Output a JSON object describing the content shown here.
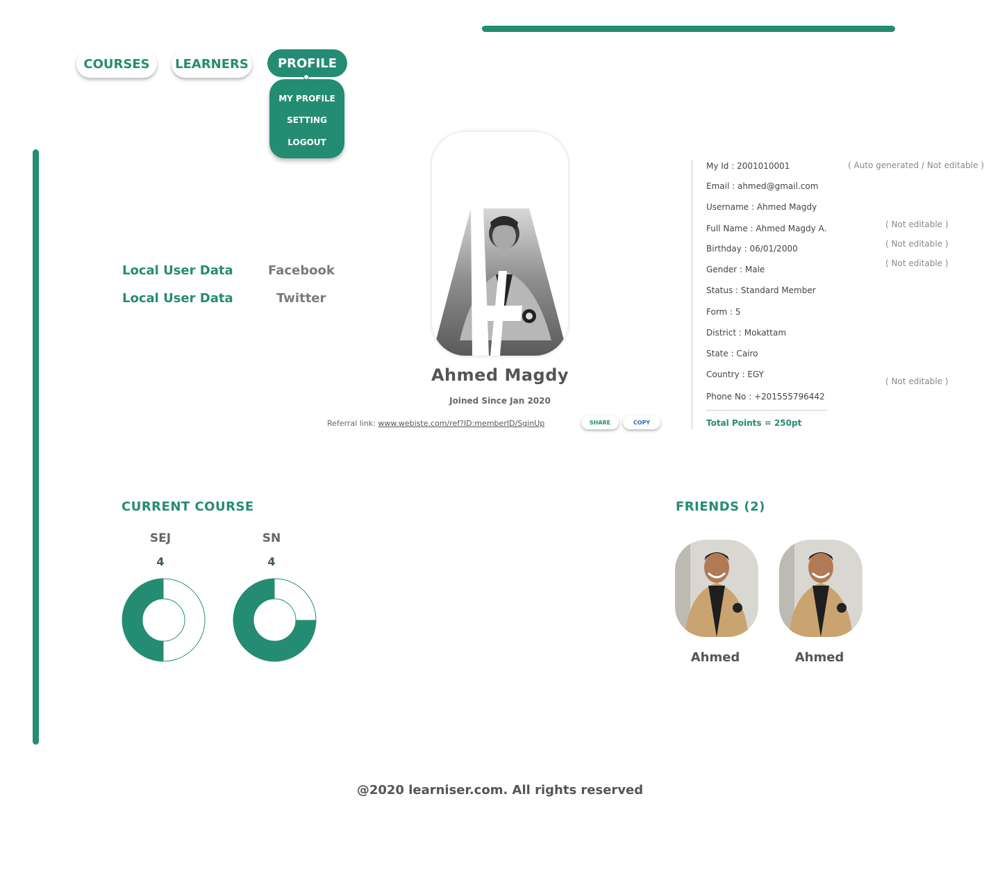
{
  "colors": {
    "accent": "#248c72",
    "text": "#555555",
    "muted": "#888888"
  },
  "nav": {
    "courses": "COURSES",
    "learners": "LEARNERS",
    "profile": "PROFILE",
    "dropdown": [
      "MY PROFILE",
      "SETTING",
      "LOGOUT"
    ]
  },
  "social": [
    {
      "label": "Local User Data",
      "link": "Facebook"
    },
    {
      "label": "Local User Data",
      "link": "Twitter"
    }
  ],
  "profile": {
    "avatar_icon": "letter-a-portrait",
    "name": "Ahmed Magdy",
    "joined": "Joined Since Jan 2020",
    "referral_label": "Referral link:",
    "referral_url": "www.webiste.com/ref?ID:memberID/SginUp",
    "share": "SHARE",
    "copy": "COPY"
  },
  "info": {
    "rows": [
      "My Id : 2001010001",
      "Email : ahmed@gmail.com",
      "Username : Ahmed Magdy",
      "Full Name : Ahmed Magdy A.",
      "Birthday : 06/01/2000",
      "Gender : Male",
      "Status : Standard Member",
      "Form : 5",
      "District : Mokattam",
      "State : Cairo",
      "Country : EGY",
      "Phone No : +201555796442"
    ],
    "notes": {
      "auto": "( Auto generated / Not editable )",
      "n1": "( Not editable )",
      "n2": "( Not editable )",
      "n3": "( Not editable )",
      "n4": "( Not editable )"
    },
    "total": "Total Points = 250pt"
  },
  "current_course": {
    "title": "CURRENT COURSE",
    "courses": [
      {
        "code": "SEJ",
        "value": "4",
        "progress": 0.5
      },
      {
        "code": "SN",
        "value": "4",
        "progress": 0.75
      }
    ]
  },
  "friends": {
    "title": "FRIENDS (2)",
    "list": [
      {
        "name": "Ahmed"
      },
      {
        "name": "Ahmed"
      }
    ]
  },
  "footer": "@2020 learniser.com. All rights reserved"
}
